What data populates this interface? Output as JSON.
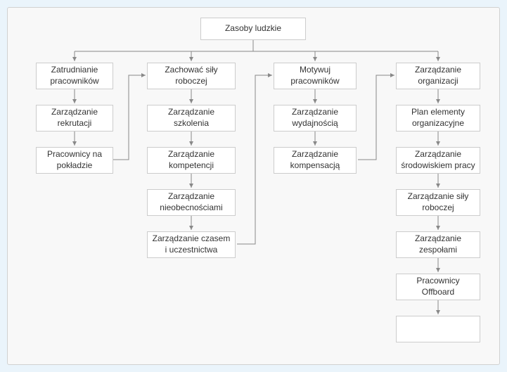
{
  "root": {
    "label": "Zasoby ludzkie"
  },
  "columns": [
    {
      "head": "Zatrudnianie pracowników",
      "items": [
        "Zarządzanie rekrutacji",
        "Pracownicy na pokładzie"
      ]
    },
    {
      "head": "Zachować siły roboczej",
      "items": [
        "Zarządzanie szkolenia",
        "Zarządzanie kompetencji",
        "Zarządzanie nieobecnościami",
        "Zarządzanie czasem i uczestnictwa"
      ]
    },
    {
      "head": "Motywuj pracowników",
      "items": [
        "Zarządzanie wydajnością",
        "Zarządzanie kompensacją"
      ]
    },
    {
      "head": "Zarządzanie organizacji",
      "items": [
        "Plan elementy organizacyjne",
        "Zarządzanie środowiskiem pracy",
        "Zarządzanie siły roboczej",
        "Zarządzanie zespołami",
        "Pracownicy Offboard"
      ]
    }
  ]
}
